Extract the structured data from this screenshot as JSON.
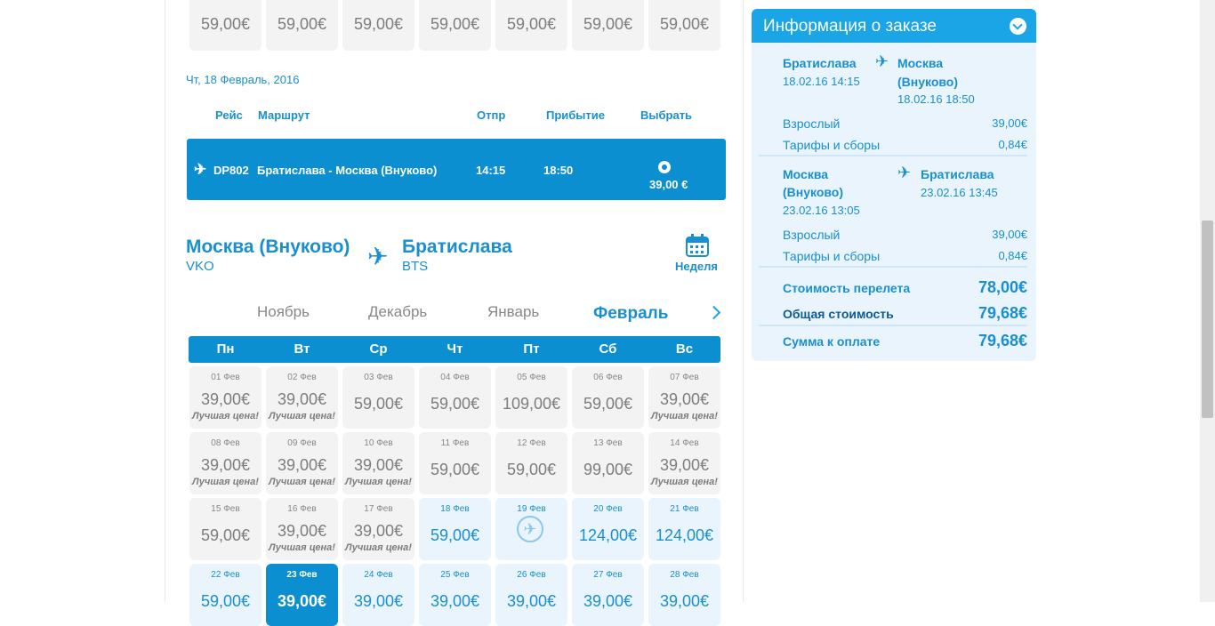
{
  "top_row": {
    "prices": [
      "59,00€",
      "59,00€",
      "59,00€",
      "59,00€",
      "59,00€",
      "59,00€",
      "59,00€"
    ]
  },
  "outbound": {
    "date": "Чт, 18 Февраль, 2016",
    "headers": {
      "flight": "Рейс",
      "route": "Маршрут",
      "dep": "Отпр",
      "arr": "Прибытие",
      "select": "Выбрать"
    },
    "flight": {
      "number": "DP802",
      "route": "Братислава - Москва (Внуково)",
      "dep": "14:15",
      "arr": "18:50",
      "price": "39,00 €",
      "icon": "plane-icon"
    }
  },
  "return_route": {
    "from_city": "Москва (Внуково)",
    "from_code": "VKO",
    "to_city": "Братислава",
    "to_code": "BTS",
    "week_label": "Неделя"
  },
  "months": [
    "Ноябрь",
    "Декабрь",
    "Январь",
    "Февраль"
  ],
  "weekdays": [
    "Пн",
    "Вт",
    "Ср",
    "Чт",
    "Пт",
    "Сб",
    "Вс"
  ],
  "calendar": {
    "best_label": "Лучшая цена!",
    "rows": [
      [
        {
          "date": "01 Фев",
          "price": "39,00€",
          "best": true
        },
        {
          "date": "02 Фев",
          "price": "39,00€",
          "best": true
        },
        {
          "date": "03 Фев",
          "price": "59,00€",
          "best": false
        },
        {
          "date": "04 Фев",
          "price": "59,00€",
          "best": false
        },
        {
          "date": "05 Фев",
          "price": "109,00€",
          "best": false
        },
        {
          "date": "06 Фев",
          "price": "59,00€",
          "best": false
        },
        {
          "date": "07 Фев",
          "price": "39,00€",
          "best": true
        }
      ],
      [
        {
          "date": "08 Фев",
          "price": "39,00€",
          "best": true
        },
        {
          "date": "09 Фев",
          "price": "39,00€",
          "best": true
        },
        {
          "date": "10 Фев",
          "price": "39,00€",
          "best": true
        },
        {
          "date": "11 Фев",
          "price": "59,00€",
          "best": false
        },
        {
          "date": "12 Фев",
          "price": "59,00€",
          "best": false
        },
        {
          "date": "13 Фев",
          "price": "99,00€",
          "best": false
        },
        {
          "date": "14 Фев",
          "price": "39,00€",
          "best": true
        }
      ],
      [
        {
          "date": "15 Фев",
          "price": "59,00€",
          "best": false
        },
        {
          "date": "16 Фев",
          "price": "39,00€",
          "best": true
        },
        {
          "date": "17 Фев",
          "price": "39,00€",
          "best": true
        },
        {
          "date": "18 Фев",
          "price": "59,00€",
          "best": false,
          "state": "light"
        },
        {
          "date": "19 Фев",
          "price": "",
          "best": false,
          "state": "light",
          "icon": "plane-circle-icon"
        },
        {
          "date": "20 Фев",
          "price": "124,00€",
          "best": false,
          "state": "light"
        },
        {
          "date": "21 Фев",
          "price": "124,00€",
          "best": false,
          "state": "light"
        }
      ],
      [
        {
          "date": "22 Фев",
          "price": "59,00€",
          "best": false,
          "state": "light"
        },
        {
          "date": "23 Фев",
          "price": "39,00€",
          "best": false,
          "state": "sel"
        },
        {
          "date": "24 Фев",
          "price": "39,00€",
          "best": false,
          "state": "light"
        },
        {
          "date": "25 Фев",
          "price": "39,00€",
          "best": false,
          "state": "light"
        },
        {
          "date": "26 Фев",
          "price": "39,00€",
          "best": false,
          "state": "light"
        },
        {
          "date": "27 Фев",
          "price": "39,00€",
          "best": false,
          "state": "light"
        },
        {
          "date": "28 Фев",
          "price": "39,00€",
          "best": false,
          "state": "light"
        }
      ]
    ]
  },
  "order": {
    "title": "Информация о заказе",
    "leg1": {
      "from": "Братислава",
      "from_dt": "18.02.16 14:15",
      "to_l1": "Москва",
      "to_l2": "(Внуково)",
      "to_dt": "18.02.16 18:50",
      "adult_label": "Взрослый",
      "adult_price": "39,00€",
      "fees_label": "Тарифы и сборы",
      "fees_price": "0,84€"
    },
    "leg2": {
      "from_l1": "Москва",
      "from_l2": "(Внуково)",
      "from_dt": "23.02.16 13:05",
      "to": "Братислава",
      "to_dt": "23.02.16 13:45",
      "adult_label": "Взрослый",
      "adult_price": "39,00€",
      "fees_label": "Тарифы и сборы",
      "fees_price": "0,84€"
    },
    "totals": {
      "flight_label": "Стоимость перелета",
      "flight_value": "78,00€",
      "total_label": "Общая стоимость",
      "total_value": "79,68€",
      "pay_label": "Сумма к оплате",
      "pay_value": "79,68€"
    }
  }
}
